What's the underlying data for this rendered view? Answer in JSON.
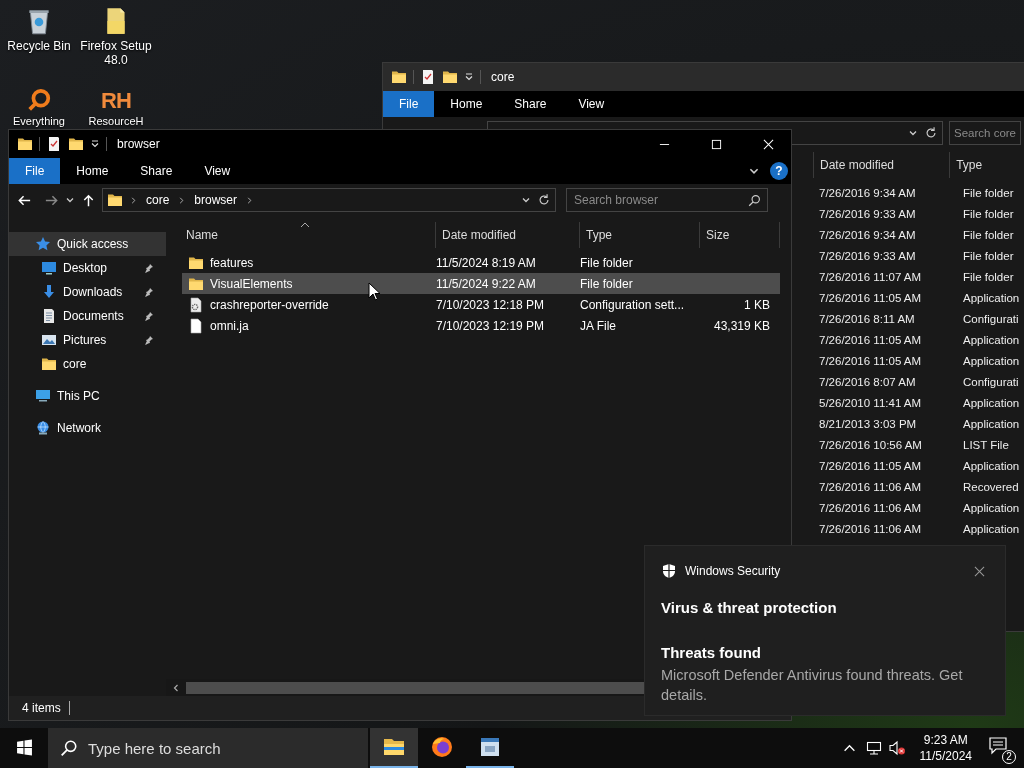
{
  "desktop_icons": [
    {
      "kind": "bin",
      "label": "Recycle Bin"
    },
    {
      "kind": "ring",
      "label": "Everything"
    },
    {
      "kind": "folder",
      "label": "Firefox Setup 48.0"
    },
    {
      "kind": "monogram",
      "glyph": "RH",
      "label": "ResourceH"
    }
  ],
  "back_window": {
    "title": "core",
    "ribbon_tabs": [
      {
        "label": "File",
        "selected": true
      },
      {
        "label": "Home",
        "selected": false
      },
      {
        "label": "Share",
        "selected": false
      },
      {
        "label": "View",
        "selected": false
      }
    ],
    "search": {
      "placeholder": "Search core"
    },
    "columns": [
      "Date modified",
      "Type"
    ],
    "rows": [
      {
        "date": "7/26/2016 9:34 AM",
        "type": "File folder"
      },
      {
        "date": "7/26/2016 9:33 AM",
        "type": "File folder"
      },
      {
        "date": "7/26/2016 9:34 AM",
        "type": "File folder"
      },
      {
        "date": "7/26/2016 9:33 AM",
        "type": "File folder"
      },
      {
        "date": "7/26/2016 11:07 AM",
        "type": "File folder"
      },
      {
        "date": "7/26/2016 11:05 AM",
        "type": "Application"
      },
      {
        "date": "7/26/2016 8:11 AM",
        "type": "Configurati"
      },
      {
        "date": "7/26/2016 11:05 AM",
        "type": "Application"
      },
      {
        "date": "7/26/2016 11:05 AM",
        "type": "Application"
      },
      {
        "date": "7/26/2016 8:07 AM",
        "type": "Configurati"
      },
      {
        "date": "5/26/2010 11:41 AM",
        "type": "Application"
      },
      {
        "date": "8/21/2013 3:03 PM",
        "type": "Application"
      },
      {
        "date": "7/26/2016 10:56 AM",
        "type": "LIST File"
      },
      {
        "date": "7/26/2016 11:05 AM",
        "type": "Application"
      },
      {
        "date": "7/26/2016 11:06 AM",
        "type": "Recovered"
      },
      {
        "date": "7/26/2016 11:06 AM",
        "type": "Application"
      },
      {
        "date": "7/26/2016 11:06 AM",
        "type": "Application"
      }
    ]
  },
  "front_window": {
    "title": "browser",
    "ribbon_tabs": [
      {
        "label": "File",
        "selected": true
      },
      {
        "label": "Home",
        "selected": false
      },
      {
        "label": "Share",
        "selected": false
      },
      {
        "label": "View",
        "selected": false
      }
    ],
    "help_label": "?",
    "path": [
      "core",
      "browser"
    ],
    "search": {
      "placeholder": "Search browser"
    },
    "nav": [
      {
        "kind": "star",
        "label": "Quick access",
        "selected": true,
        "children": [
          {
            "kind": "desktop",
            "label": "Desktop",
            "pinned": true,
            "selected": false
          },
          {
            "kind": "download",
            "label": "Downloads",
            "pinned": true,
            "selected": false
          },
          {
            "kind": "document",
            "label": "Documents",
            "pinned": true,
            "selected": false
          },
          {
            "kind": "picture",
            "label": "Pictures",
            "pinned": true,
            "selected": false
          },
          {
            "kind": "folder",
            "label": "core",
            "pinned": false,
            "selected": false
          }
        ]
      },
      {
        "kind": "pc",
        "label": "This PC",
        "selected": false
      },
      {
        "kind": "network",
        "label": "Network",
        "selected": false
      }
    ],
    "columns": [
      {
        "label": "Name",
        "sorted": true
      },
      {
        "label": "Date modified",
        "sorted": false
      },
      {
        "label": "Type",
        "sorted": false
      },
      {
        "label": "Size",
        "sorted": false
      }
    ],
    "rows": [
      {
        "kind": "folder",
        "name": "features",
        "date": "11/5/2024 8:19 AM",
        "type": "File folder",
        "highlighted": false
      },
      {
        "kind": "folder",
        "name": "VisualElements",
        "date": "11/5/2024 9:22 AM",
        "type": "File folder",
        "highlighted": true
      },
      {
        "kind": "config",
        "name": "crashreporter-override",
        "date": "7/10/2023 12:18 PM",
        "type": "Configuration sett...",
        "size": "1 KB",
        "highlighted": false
      },
      {
        "kind": "file",
        "name": "omni.ja",
        "date": "7/10/2023 12:19 PM",
        "type": "JA File",
        "size": "43,319 KB",
        "highlighted": false
      }
    ],
    "status": "4 items"
  },
  "notification": {
    "app": "Windows Security",
    "title": "Virus & threat protection",
    "heading": "Threats found",
    "body": "Microsoft Defender Antivirus found threats. Get details."
  },
  "taskbar": {
    "search": {
      "placeholder": "Type here to search"
    },
    "apps": [
      {
        "kind": "explorer",
        "active": true,
        "running": true
      },
      {
        "kind": "firefox",
        "active": false,
        "running": false
      },
      {
        "kind": "window",
        "active": false,
        "running": true
      }
    ],
    "muted": true,
    "time": "9:23 AM",
    "date": "11/5/2024",
    "notification_count": "2"
  }
}
